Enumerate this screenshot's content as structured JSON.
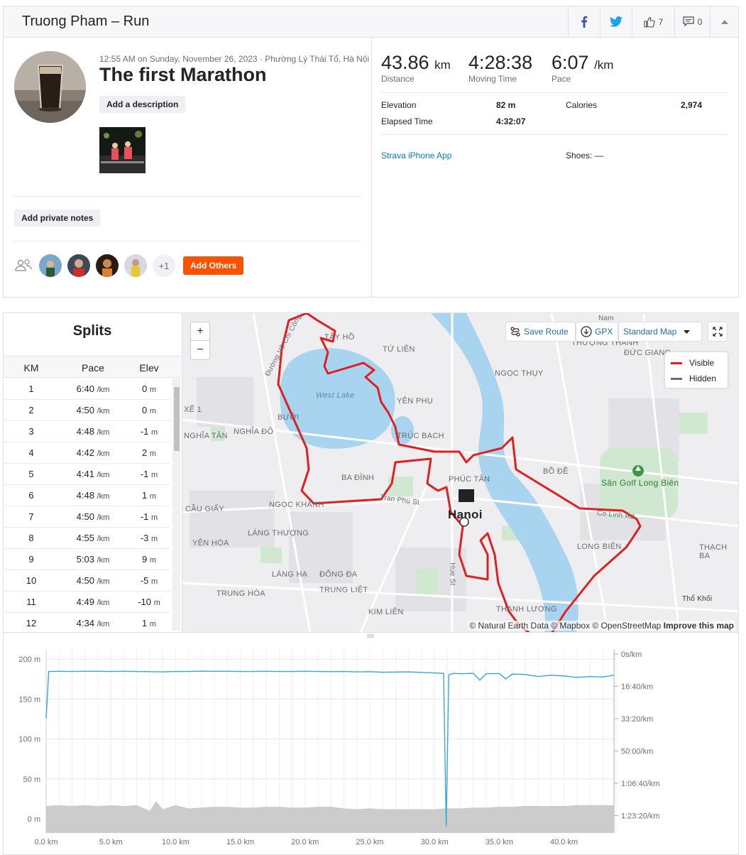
{
  "header": {
    "title": "Truong Pham – Run",
    "kudos_count": "7",
    "comments_count": "0",
    "icons": [
      "facebook-icon",
      "twitter-icon",
      "thumbs-up-icon",
      "comment-icon",
      "caret-up-icon"
    ]
  },
  "activity": {
    "meta": "12:55 AM on Sunday, November 26, 2023 · Phường Lý Thái Tổ, Hà Nội",
    "title": "The first Marathon",
    "add_description": "Add a description",
    "add_private_notes": "Add private notes",
    "group_more": "+1",
    "add_others": "Add Others"
  },
  "stats": {
    "distance": "43.86",
    "distance_unit": "km",
    "distance_label": "Distance",
    "moving_time": "4:28:38",
    "moving_time_label": "Moving Time",
    "pace": "6:07",
    "pace_unit": "/km",
    "pace_label": "Pace",
    "elevation_label": "Elevation",
    "elevation": "82 m",
    "calories_label": "Calories",
    "calories": "2,974",
    "elapsed_label": "Elapsed Time",
    "elapsed": "4:32:07",
    "device": "Strava iPhone App",
    "shoes": "Shoes: —"
  },
  "splits": {
    "title": "Splits",
    "headers": {
      "km": "KM",
      "pace": "Pace",
      "elev": "Elev"
    },
    "pace_unit": "/km",
    "elev_unit": "m",
    "rows": [
      {
        "km": "1",
        "pace": "6:40",
        "elev": "0"
      },
      {
        "km": "2",
        "pace": "4:50",
        "elev": "0"
      },
      {
        "km": "3",
        "pace": "4:48",
        "elev": "-1"
      },
      {
        "km": "4",
        "pace": "4:42",
        "elev": "2"
      },
      {
        "km": "5",
        "pace": "4:41",
        "elev": "-1"
      },
      {
        "km": "6",
        "pace": "4:48",
        "elev": "1"
      },
      {
        "km": "7",
        "pace": "4:50",
        "elev": "-1"
      },
      {
        "km": "8",
        "pace": "4:55",
        "elev": "-3"
      },
      {
        "km": "9",
        "pace": "5:03",
        "elev": "9"
      },
      {
        "km": "10",
        "pace": "4:50",
        "elev": "-5"
      },
      {
        "km": "11",
        "pace": "4:49",
        "elev": "-10"
      },
      {
        "km": "12",
        "pace": "4:34",
        "elev": "1"
      }
    ]
  },
  "map": {
    "zoom_in": "+",
    "zoom_out": "−",
    "save_route": "Save Route",
    "gpx": "GPX",
    "style": "Standard Map",
    "legend_visible": "Visible",
    "legend_hidden": "Hidden",
    "route_color": "#e02020",
    "hidden_color": "#6d6d78",
    "attribution": "© Natural Earth Data © Mapbox © OpenStreetMap",
    "improve": "Improve this map",
    "labels": {
      "tay_ho": "TÂY HỒ",
      "tu_lien": "TỨ LIÊN",
      "west_lake": "West Lake",
      "yen_phu": "YÊN PHỤ",
      "truc_bach": "TRÚC BẠCH",
      "ba_dinh": "BA ĐÌNH",
      "phuc_tan": "PHÚC TÂN",
      "hanoi": "Hanoi",
      "ngoc_thuy": "NGỌC THỤY",
      "bo_de": "BỒ ĐỀ",
      "golf": "Sân Golf Long Biên",
      "long_bien": "LONG BIÊN",
      "thach_ban": "THẠCH BA",
      "cau_giay": "CẦU GIẤY",
      "ngoc_khanh": "NGỌC KHÁNH",
      "lang_thuong": "LÁNG THƯỢNG",
      "yen_hoa": "YÊN HÒA",
      "lang_ha": "LÁNG HẠ",
      "dong_da": "ĐỐNG ĐA",
      "trung_hoa": "TRUNG HÒA",
      "trung_liet": "TRUNG LIỆT",
      "kim_lien": "KIM LIÊN",
      "thanh_luong": "THANH LƯƠNG",
      "nghia_tan": "NGHĨA TÂN",
      "nghia_do": "NGHĨA ĐÔ",
      "buoi": "BƯỞI",
      "thuong_thanh": "THƯỢNG THANH",
      "duc_giang": "ĐỨC GIANG",
      "tran_phu": "Tran Phu St",
      "hue_st": "Hue St",
      "duong_vo_chi_cong": "Đường Võ Chí Công",
      "co_linh": "Co Linh Rd",
      "tho_khoi": "Thổ Khối",
      "xe1": "XẾ 1",
      "nam": "Nam"
    }
  },
  "chart_data": {
    "type": "line",
    "x_label_unit": "km",
    "x_ticks": [
      "0.0 km",
      "5.0 km",
      "10.0 km",
      "15.0 km",
      "20.0 km",
      "25.0 km",
      "30.0 km",
      "35.0 km",
      "40.0 km"
    ],
    "xlim": [
      0,
      43.86
    ],
    "y_left_ticks": [
      "200 m",
      "150 m",
      "100 m",
      "50 m",
      "0 m"
    ],
    "y_left_lim": [
      0,
      210
    ],
    "y_right_ticks": [
      "0s/km",
      "16:40/km",
      "33:20/km",
      "50:00/km",
      "1:06:40/km",
      "1:23:20/km"
    ],
    "series": [
      {
        "kind": "elevation",
        "unit": "m",
        "color": "#cccccc",
        "x": [
          0,
          1,
          2,
          3,
          4,
          5,
          6,
          7,
          8,
          8.5,
          9,
          10,
          11,
          12,
          13,
          14,
          15,
          16,
          17,
          18,
          19,
          20,
          21,
          22,
          23,
          24,
          25,
          26,
          27,
          28,
          29,
          30,
          31,
          32,
          33,
          34,
          35,
          36,
          37,
          38,
          39,
          40,
          41,
          42,
          43,
          43.86
        ],
        "values": [
          16,
          17,
          16,
          17,
          16,
          17,
          16,
          17,
          10,
          22,
          12,
          17,
          13,
          14,
          15,
          15,
          14,
          14,
          15,
          15,
          14,
          14,
          15,
          15,
          13,
          12,
          13,
          12,
          12,
          12,
          12,
          12,
          13,
          13,
          14,
          14,
          15,
          15,
          16,
          16,
          16,
          16,
          17,
          17,
          17,
          17
        ]
      },
      {
        "kind": "pace",
        "unit": "min/km",
        "color": "#3aa7d9",
        "x": [
          0,
          0.2,
          1,
          2,
          3,
          4,
          5,
          6,
          7,
          8,
          9,
          10,
          11,
          12,
          13,
          14,
          15,
          16,
          17,
          18,
          19,
          20,
          21,
          22,
          23,
          24,
          25,
          26,
          27,
          28,
          29,
          30,
          30.7,
          30.9,
          31.1,
          31.5,
          32,
          33,
          33.5,
          34,
          35,
          35.5,
          36,
          37,
          38,
          39,
          40,
          41,
          42,
          43,
          43.86
        ],
        "values": [
          30,
          4.8,
          4.7,
          4.8,
          4.7,
          4.7,
          4.8,
          4.7,
          4.8,
          4.9,
          5.0,
          4.8,
          4.8,
          4.6,
          4.7,
          4.7,
          4.8,
          4.8,
          4.7,
          4.8,
          4.8,
          4.7,
          4.8,
          4.9,
          4.8,
          5.0,
          4.9,
          5.2,
          5.1,
          5.0,
          5.3,
          5.6,
          5.8,
          88,
          6.5,
          5.8,
          6.0,
          5.8,
          9.5,
          6.0,
          5.9,
          8.8,
          6.2,
          6.4,
          7.5,
          6.8,
          7.2,
          8.0,
          7.5,
          7.8,
          6.8
        ]
      }
    ]
  }
}
